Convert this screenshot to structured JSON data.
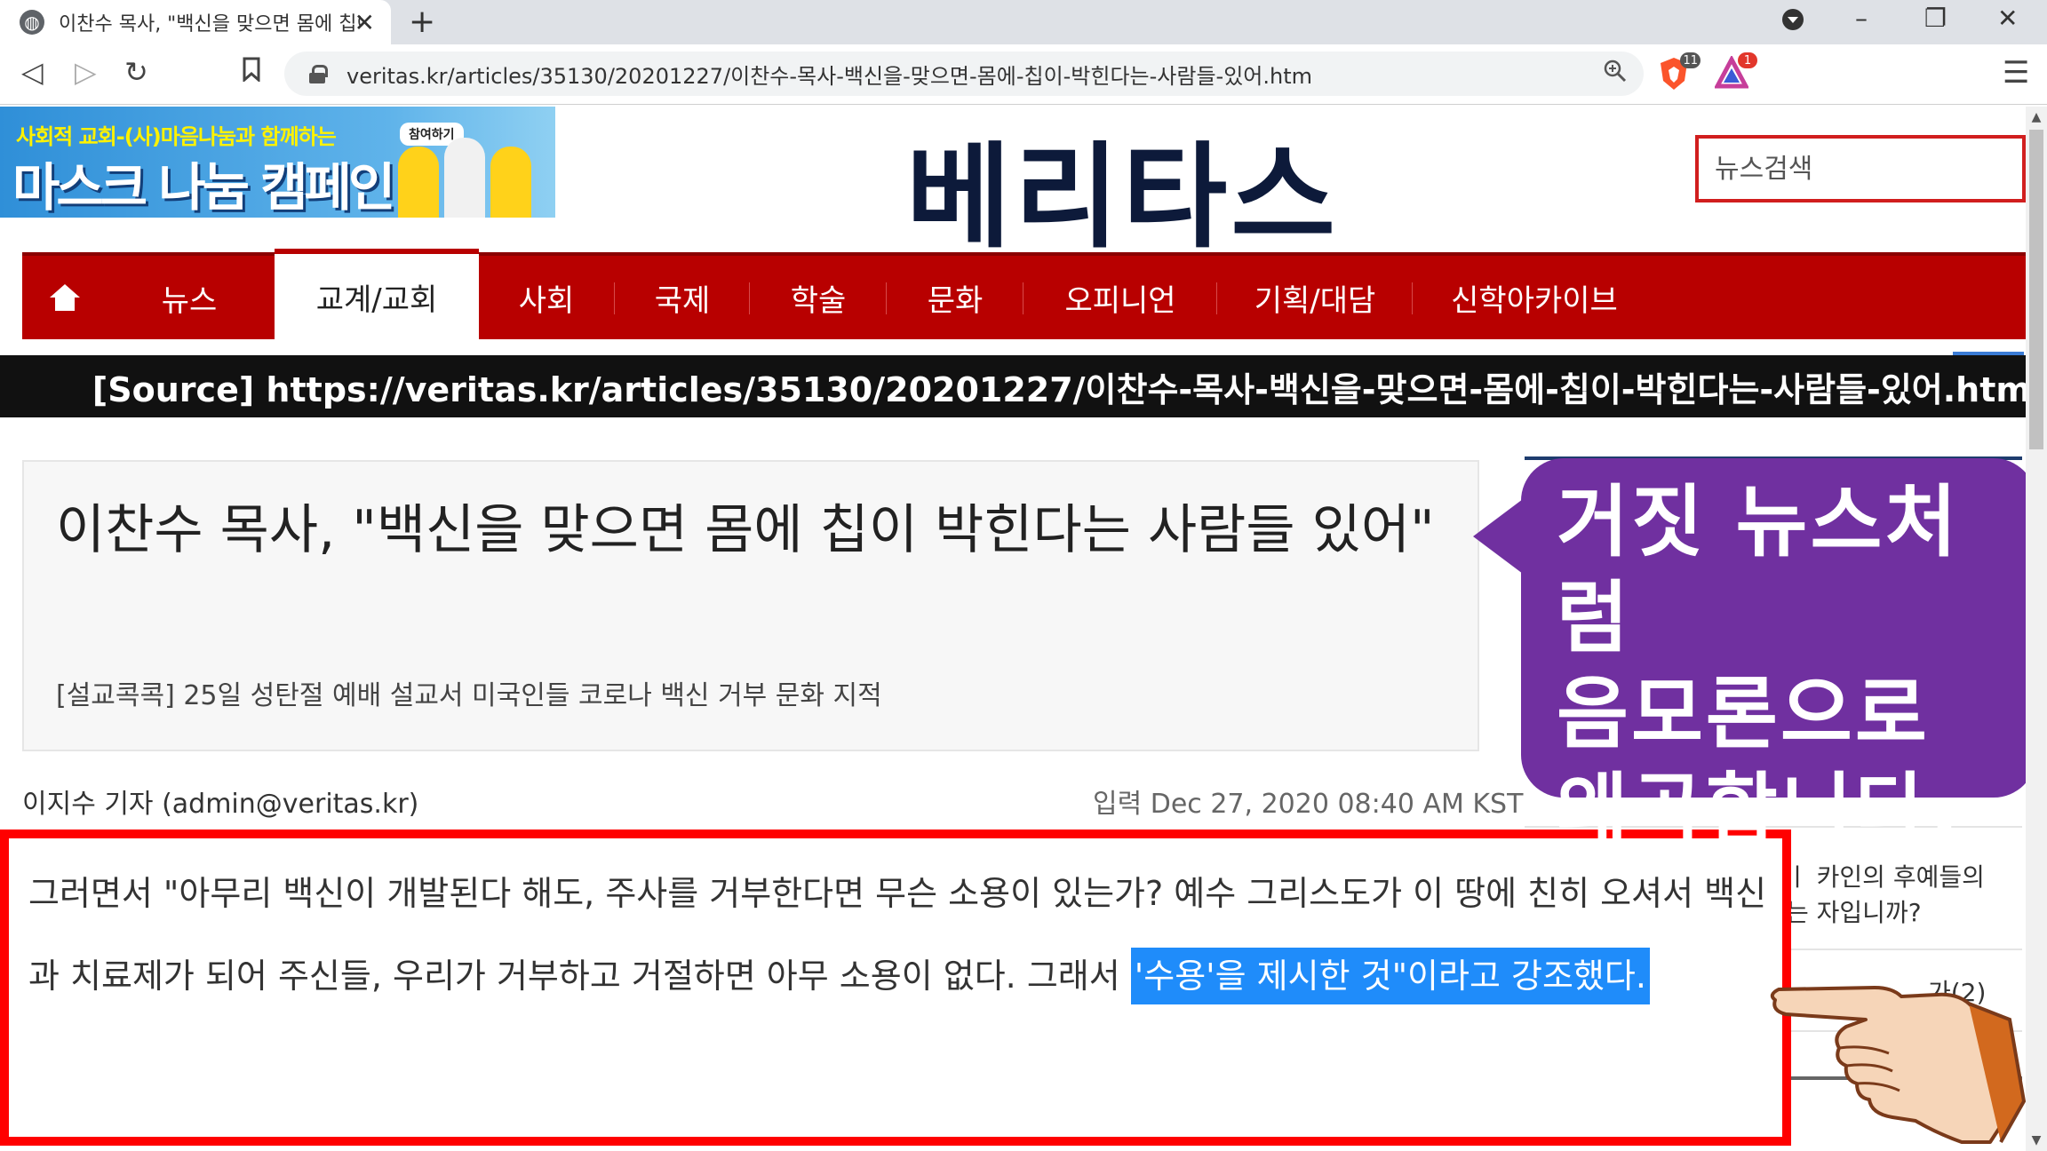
{
  "browser": {
    "tab_title": "이찬수 목사, \"백신을 맞으면 몸에 칩이 박힌다는 사람들 있어\"",
    "url": "veritas.kr/articles/35130/20201227/이찬수-목사-백신을-맞으면-몸에-칩이-박힌다는-사람들-있어.htm",
    "brave_badge": "11",
    "alert_badge": "1"
  },
  "banner": {
    "top_text": "사회적 교회-(사)마음나눔과 함께하는",
    "main_text": "마스크 나눔 캠페인",
    "join_label": "참여하기"
  },
  "site": {
    "logo": "베리타스",
    "search_placeholder": "뉴스검색"
  },
  "nav": {
    "items": [
      "뉴스",
      "교계/교회",
      "사회",
      "국제",
      "학술",
      "문화",
      "오피니언",
      "기획/대담",
      "신학아카이브"
    ],
    "active_item": "교계/교회"
  },
  "source_bar": "[Source]  https://veritas.kr/articles/35130/20201227/이찬수-목사-백신을-맞으면-몸에-칩이-박힌다는-사람들-있어.htm",
  "article": {
    "title": "이찬수 목사, \"백신을 맞으면 몸에 칩이 박힌다는 사람들 있어\"",
    "subtitle": "[설교콕콕] 25일 성탄절 예배 설교서 미국인들 코로나 백신 거부 문화 지적",
    "byline": "이지수 기자 (admin@veritas.kr)",
    "timestamp": "입력 Dec 27, 2020 08:40 AM KST",
    "quote_plain": "그러면서 \"아무리 백신이 개발된다 해도, 주사를 거부한다면 무슨 소용이 있는가? 예수 그리스도가 이 땅에 친히 오셔서 백신과 치료제가 되어 주신들, 우리가 거부하고 거절하면 아무 소용이 없다. 그래서 ",
    "quote_highlight": "'수용'을 제시한 것\"이라고 강조했다."
  },
  "sidebar": {
    "line1": "ㅣ 카인의 후예들의",
    "line2": "는 자입니까?",
    "line3": "가(2)"
  },
  "callout": {
    "lines": [
      "거짓 뉴스처럼",
      "음모론으로",
      "왜곡합니다."
    ]
  },
  "colors": {
    "nav_red": "#b80000",
    "search_border": "#d11e1e",
    "highlight_blue": "#1f8cfa",
    "callout_purple": "#7030a0",
    "quote_border": "#ff0000"
  }
}
